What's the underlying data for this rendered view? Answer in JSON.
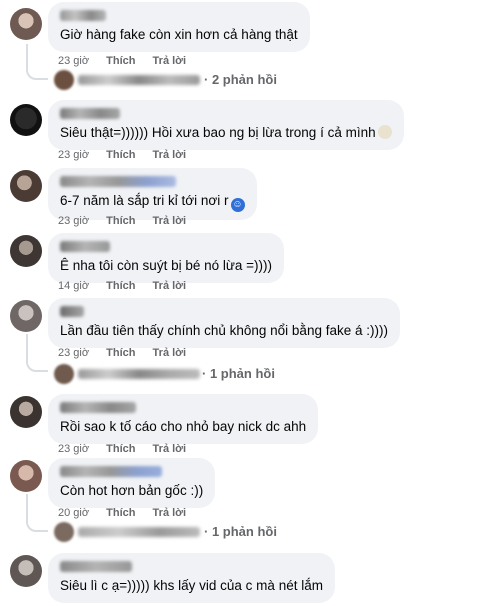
{
  "comments": [
    {
      "text": "Giờ hàng fake còn xin hơn cả hàng thật",
      "time": "23 giờ",
      "like": "Thích",
      "reply": "Trả lời",
      "replies": "· 2 phản hồi"
    },
    {
      "text": "Siêu thật=)))))) Hồi xưa bao ng bị lừa trong í cả mình",
      "time": "23 giờ",
      "like": "Thích",
      "reply": "Trả lời",
      "emoji": "smile-icon"
    },
    {
      "text": "6-7 năm là sắp tri kỉ tới nơi r",
      "time": "23 giờ",
      "like": "Thích",
      "reply": "Trả lời",
      "emoji": "clown-icon"
    },
    {
      "text": "Ê nha tôi còn suýt bị bé nó lừa =))))",
      "time": "14 giờ",
      "like": "Thích",
      "reply": "Trả lời"
    },
    {
      "text": "Lần đầu tiên thấy chính chủ không nổi bằng fake á :))))",
      "time": "23 giờ",
      "like": "Thích",
      "reply": "Trả lời",
      "replies": "· 1 phản hồi"
    },
    {
      "text": "Rồi sao k tố cáo cho nhỏ bay nick dc ahh",
      "time": "23 giờ",
      "like": "Thích",
      "reply": "Trả lời"
    },
    {
      "text": "Còn hot hơn bản gốc :))",
      "time": "20 giờ",
      "like": "Thích",
      "reply": "Trả lời",
      "replies": "· 1 phản hồi"
    },
    {
      "text": "Siêu lì c ạ=))))) khs lấy vid của c mà nét lắm",
      "time": "",
      "like": "",
      "reply": ""
    }
  ],
  "colors": {
    "bubble": "#f0f2f5",
    "meta": "#65676b",
    "text": "#050505",
    "thread_line": "#dadde1"
  }
}
